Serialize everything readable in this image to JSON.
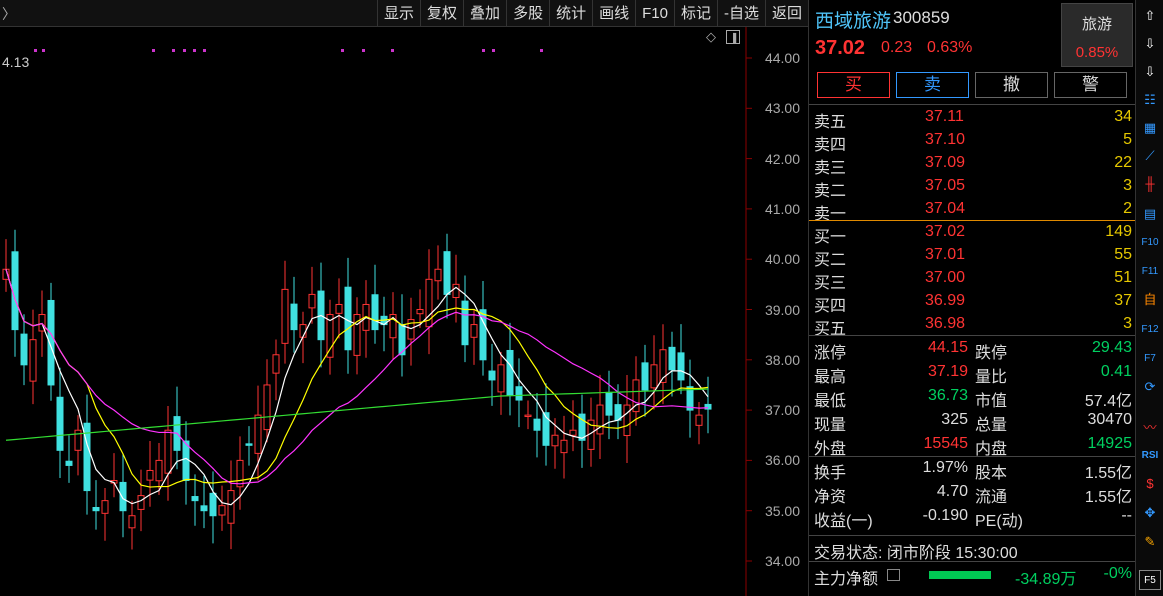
{
  "toolbar": {
    "back_glyph": "〉",
    "items": [
      "显示",
      "复权",
      "叠加",
      "多股",
      "统计",
      "画线",
      "F10",
      "标记",
      "-自选",
      "返回"
    ]
  },
  "chart": {
    "max_label": "4.13",
    "y_ticks": [
      "44.00",
      "43.00",
      "42.00",
      "41.00",
      "40.00",
      "39.00",
      "38.00",
      "37.00",
      "36.00",
      "35.00",
      "34.00"
    ]
  },
  "colors": {
    "up": "#ff3333",
    "down": "#40e0e0",
    "ma5": "#ffffff",
    "ma10": "#ffff00",
    "ma20": "#ff33ff",
    "ma60": "#33dd33",
    "marker": "#cc33cc"
  },
  "stock": {
    "name": "西域旅游",
    "code": "300859",
    "price": "37.02",
    "change": "0.23",
    "change_pct": "0.63%",
    "sector_name": "旅游",
    "sector_pct": "0.85%"
  },
  "trade_buttons": [
    "买",
    "卖",
    "撤",
    "警"
  ],
  "asks": [
    {
      "label": "卖五",
      "price": "37.11",
      "vol": "34"
    },
    {
      "label": "卖四",
      "price": "37.10",
      "vol": "5"
    },
    {
      "label": "卖三",
      "price": "37.09",
      "vol": "22"
    },
    {
      "label": "卖二",
      "price": "37.05",
      "vol": "3"
    },
    {
      "label": "卖一",
      "price": "37.04",
      "vol": "2"
    }
  ],
  "bids": [
    {
      "label": "买一",
      "price": "37.02",
      "vol": "149"
    },
    {
      "label": "买二",
      "price": "37.01",
      "vol": "55"
    },
    {
      "label": "买三",
      "price": "37.00",
      "vol": "51"
    },
    {
      "label": "买四",
      "price": "36.99",
      "vol": "37"
    },
    {
      "label": "买五",
      "price": "36.98",
      "vol": "3"
    }
  ],
  "stats": [
    {
      "l1": "涨停",
      "v1": "44.15",
      "c1": "#ff3333",
      "l2": "跌停",
      "v2": "29.43",
      "c2": "#00d060"
    },
    {
      "l1": "最高",
      "v1": "37.19",
      "c1": "#ff3333",
      "l2": "量比",
      "v2": "0.41",
      "c2": "#00d060"
    },
    {
      "l1": "最低",
      "v1": "36.73",
      "c1": "#00d060",
      "l2": "市值",
      "v2": "57.4亿",
      "c2": "#dddddd"
    },
    {
      "l1": "现量",
      "v1": "325",
      "c1": "#dddddd",
      "l2": "总量",
      "v2": "30470",
      "c2": "#dddddd"
    },
    {
      "l1": "外盘",
      "v1": "15545",
      "c1": "#ff3333",
      "l2": "内盘",
      "v2": "14925",
      "c2": "#00d060"
    },
    {
      "l1": "换手",
      "v1": "1.97%",
      "c1": "#dddddd",
      "l2": "股本",
      "v2": "1.55亿",
      "c2": "#dddddd"
    },
    {
      "l1": "净资",
      "v1": "4.70",
      "c1": "#dddddd",
      "l2": "流通",
      "v2": "1.55亿",
      "c2": "#dddddd"
    },
    {
      "l1": "收益(一)",
      "v1": "-0.190",
      "c1": "#dddddd",
      "l2": "PE(动)",
      "v2": "--",
      "c2": "#dddddd"
    }
  ],
  "status": {
    "label": "交易状态: 闭市阶段 15:30:00"
  },
  "flow": {
    "label": "主力净额",
    "value": "-34.89万",
    "pct": "-0%"
  },
  "icons": [
    "up-arrow-icon",
    "down-arrow-icon",
    "list-icon",
    "grid-icon",
    "line-chart-icon",
    "candle-icon",
    "news-icon",
    "f10-icon",
    "f11-icon",
    "self-icon",
    "f12-icon",
    "f7-icon",
    "refresh-icon",
    "wave-icon",
    "rsi-icon",
    "dollar-icon",
    "move-icon",
    "pencil-icon",
    "f5-icon"
  ]
}
